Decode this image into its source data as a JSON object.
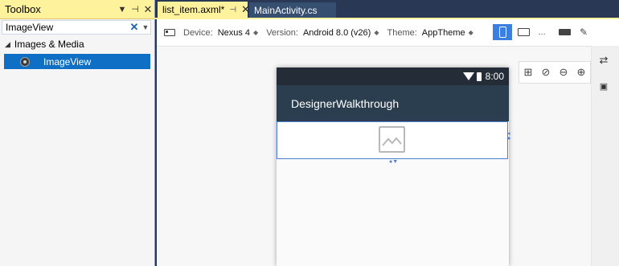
{
  "toolbox": {
    "title": "Toolbox",
    "search_value": "ImageView",
    "category": "Images & Media",
    "item": "ImageView"
  },
  "tabs": [
    {
      "label": "list_item.axml*"
    },
    {
      "label": "MainActivity.cs"
    }
  ],
  "designer_toolbar": {
    "device_label": "Device:",
    "device_value": "Nexus 4",
    "version_label": "Version:",
    "version_value": "Android 8.0 (v26)",
    "theme_label": "Theme:",
    "theme_value": "AppTheme"
  },
  "phone": {
    "time": "8:00",
    "app_title": "DesignerWalkthrough"
  },
  "colors": {
    "ide_background": "#293955",
    "active_tab": "#fff29d",
    "selection": "#0e6fc4",
    "app_bar": "#2b3e50",
    "status_bar": "#242c37"
  }
}
